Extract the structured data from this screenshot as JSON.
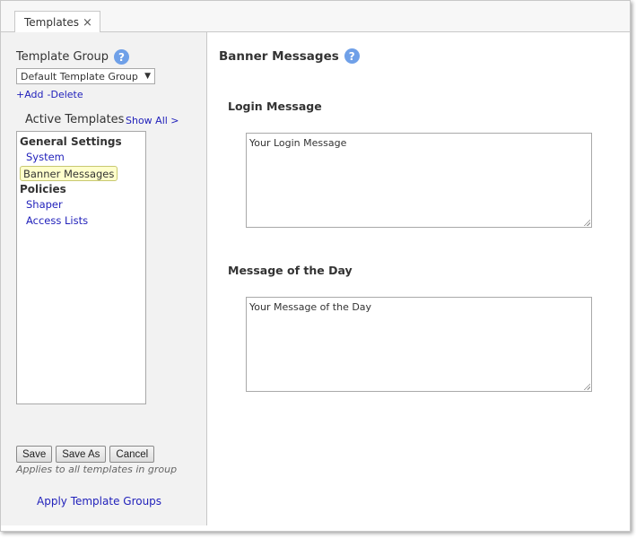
{
  "tabs": [
    {
      "label": "Templates",
      "close_glyph": "×"
    }
  ],
  "left_panel": {
    "template_group_label": "Template Group",
    "help_glyph": "?",
    "group_select": {
      "selected": "Default Template Group"
    },
    "add_label": "+Add",
    "delete_label": "-Delete",
    "active_templates_label": "Active Templates",
    "show_all_label": "Show All >",
    "tree": [
      {
        "type": "heading",
        "label": "General Settings"
      },
      {
        "type": "item",
        "label": "System"
      },
      {
        "type": "item",
        "label": "Banner Messages",
        "selected": true
      },
      {
        "type": "heading",
        "label": "Policies"
      },
      {
        "type": "item",
        "label": "Shaper"
      },
      {
        "type": "item",
        "label": "Access Lists"
      }
    ],
    "buttons": {
      "save": "Save",
      "save_as": "Save As",
      "cancel": "Cancel"
    },
    "applies_note": "Applies to all templates in group",
    "apply_groups_link": "Apply Template Groups"
  },
  "main": {
    "title": "Banner Messages",
    "login_section": {
      "label": "Login Message",
      "value": "Your Login Message"
    },
    "motd_section": {
      "label": "Message of the Day",
      "value": "Your Message of the Day"
    }
  },
  "colors": {
    "link": "#2222bb",
    "help_icon": "#6fa0e8",
    "selected_bg": "#ffffcc",
    "panel_bg": "#f2f2f2"
  }
}
